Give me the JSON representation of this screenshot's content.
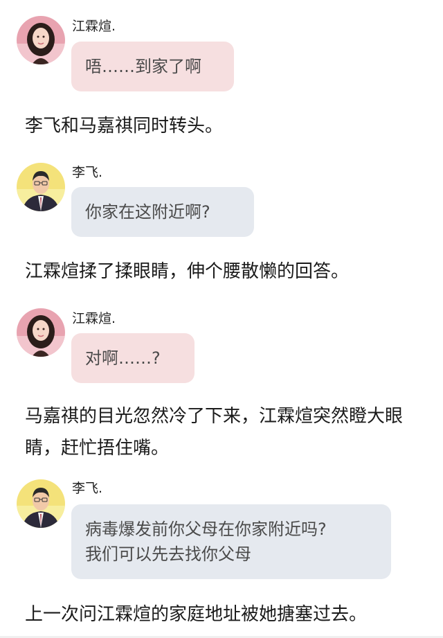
{
  "messages": [
    {
      "speaker": "江霖煊.",
      "text": "唔……到家了啊",
      "avatar": "girl-avatar"
    },
    {
      "speaker": "李飞.",
      "text": "你家在这附近啊?",
      "avatar": "man-avatar"
    },
    {
      "speaker": "江霖煊.",
      "text": "对啊……?",
      "avatar": "girl-avatar"
    },
    {
      "speaker": "李飞.",
      "text_line1": "病毒爆发前你父母在你家附近吗?",
      "text_line2": "我们可以先去找你父母",
      "avatar": "man-avatar"
    }
  ],
  "narration": [
    "李飞和马嘉祺同时转头。",
    "江霖煊揉了揉眼睛，伸个腰散懒的回答。",
    "马嘉祺的目光忽然冷了下来，江霖煊突然瞪大眼睛，赶忙捂住嘴。",
    "上一次问江霖煊的家庭地址被她搪塞过去。"
  ],
  "colors": {
    "pink_bubble": "#f6dfe0",
    "blue_bubble": "#e5e9ef"
  }
}
